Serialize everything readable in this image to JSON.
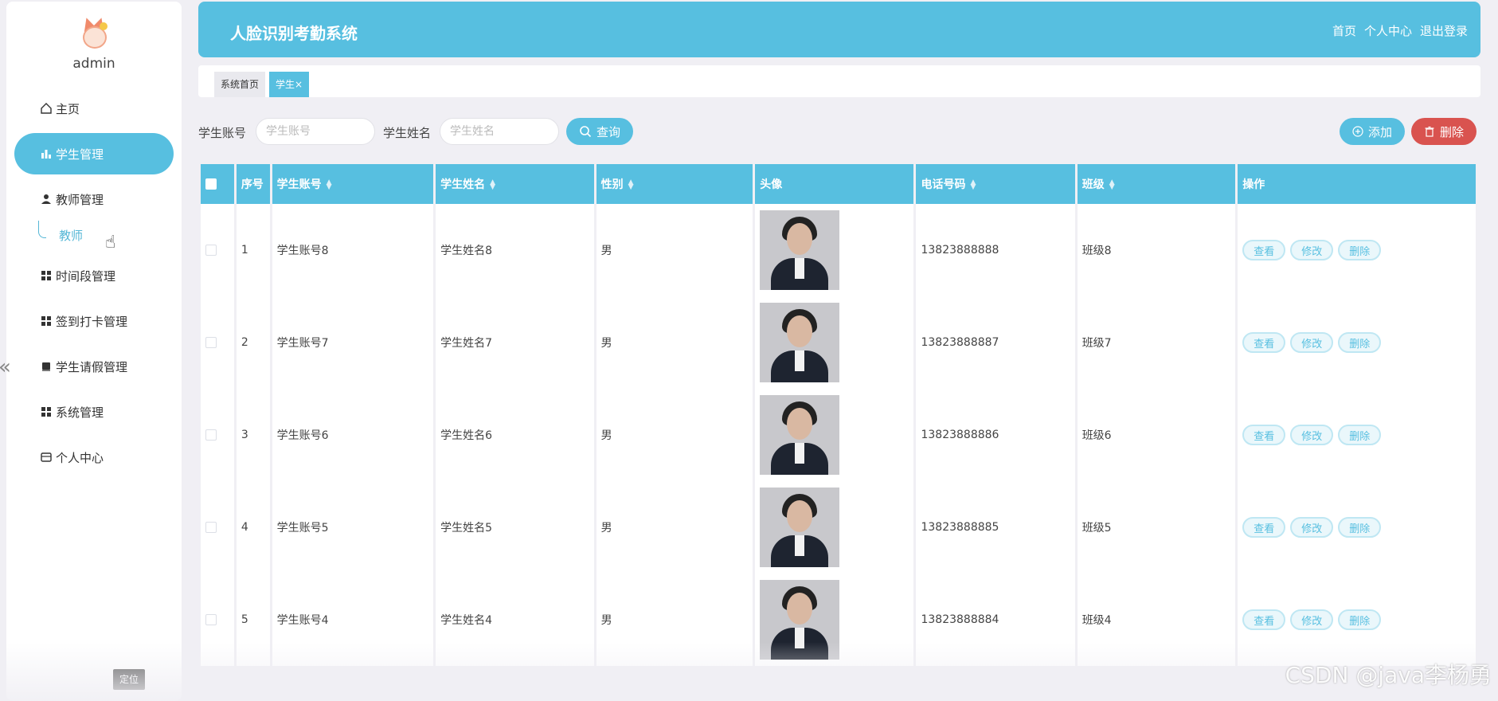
{
  "sidebar": {
    "user": "admin",
    "items": [
      {
        "label": "主页",
        "icon": "home-icon"
      },
      {
        "label": "学生管理",
        "icon": "bar-chart-icon"
      },
      {
        "label": "教师管理",
        "icon": "person-icon"
      },
      {
        "label": "时间段管理",
        "icon": "grid-icon"
      },
      {
        "label": "签到打卡管理",
        "icon": "grid-icon"
      },
      {
        "label": "学生请假管理",
        "icon": "book-icon"
      },
      {
        "label": "系统管理",
        "icon": "grid-icon"
      },
      {
        "label": "个人中心",
        "icon": "card-icon"
      }
    ],
    "sub_item": "教师",
    "locate": "定位"
  },
  "header": {
    "title": "人脸识别考勤系统",
    "links": [
      "首页",
      "个人中心",
      "退出登录"
    ]
  },
  "tabs": [
    {
      "label": "系统首页"
    },
    {
      "label": "学生",
      "close": "×"
    }
  ],
  "search": {
    "account_label": "学生账号",
    "account_placeholder": "学生账号",
    "name_label": "学生姓名",
    "name_placeholder": "学生姓名",
    "query_label": "查询",
    "add_label": "添加",
    "delete_label": "删除"
  },
  "table": {
    "headers": [
      "序号",
      "学生账号",
      "学生姓名",
      "性别",
      "头像",
      "电话号码",
      "班级",
      "操作"
    ],
    "sortable": [
      false,
      true,
      true,
      true,
      false,
      true,
      true,
      false
    ],
    "rows": [
      {
        "no": "1",
        "account": "学生账号8",
        "name": "学生姓名8",
        "gender": "男",
        "phone": "13823888888",
        "class": "班级8"
      },
      {
        "no": "2",
        "account": "学生账号7",
        "name": "学生姓名7",
        "gender": "男",
        "phone": "13823888887",
        "class": "班级7"
      },
      {
        "no": "3",
        "account": "学生账号6",
        "name": "学生姓名6",
        "gender": "男",
        "phone": "13823888886",
        "class": "班级6"
      },
      {
        "no": "4",
        "account": "学生账号5",
        "name": "学生姓名5",
        "gender": "男",
        "phone": "13823888885",
        "class": "班级5"
      },
      {
        "no": "5",
        "account": "学生账号4",
        "name": "学生姓名4",
        "gender": "男",
        "phone": "13823888884",
        "class": "班级4"
      }
    ],
    "ops": [
      "查看",
      "修改",
      "删除"
    ]
  },
  "watermark": "CSDN @java李杨勇",
  "colors": {
    "accent": "#57bfe0",
    "danger": "#d9534f"
  }
}
